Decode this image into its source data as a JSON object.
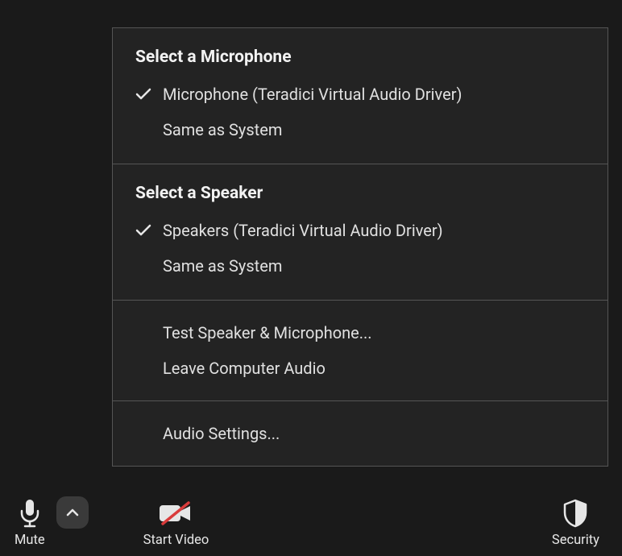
{
  "menu": {
    "mic": {
      "title": "Select a Microphone",
      "items": [
        {
          "label": "Microphone (Teradici Virtual Audio Driver)",
          "selected": true
        },
        {
          "label": "Same as System",
          "selected": false
        }
      ]
    },
    "speaker": {
      "title": "Select a Speaker",
      "items": [
        {
          "label": "Speakers (Teradici Virtual Audio Driver)",
          "selected": true
        },
        {
          "label": "Same as System",
          "selected": false
        }
      ]
    },
    "actions1": [
      "Test Speaker & Microphone...",
      "Leave Computer Audio"
    ],
    "actions2": [
      "Audio Settings..."
    ]
  },
  "toolbar": {
    "mute": "Mute",
    "start_video": "Start Video",
    "security": "Security"
  }
}
